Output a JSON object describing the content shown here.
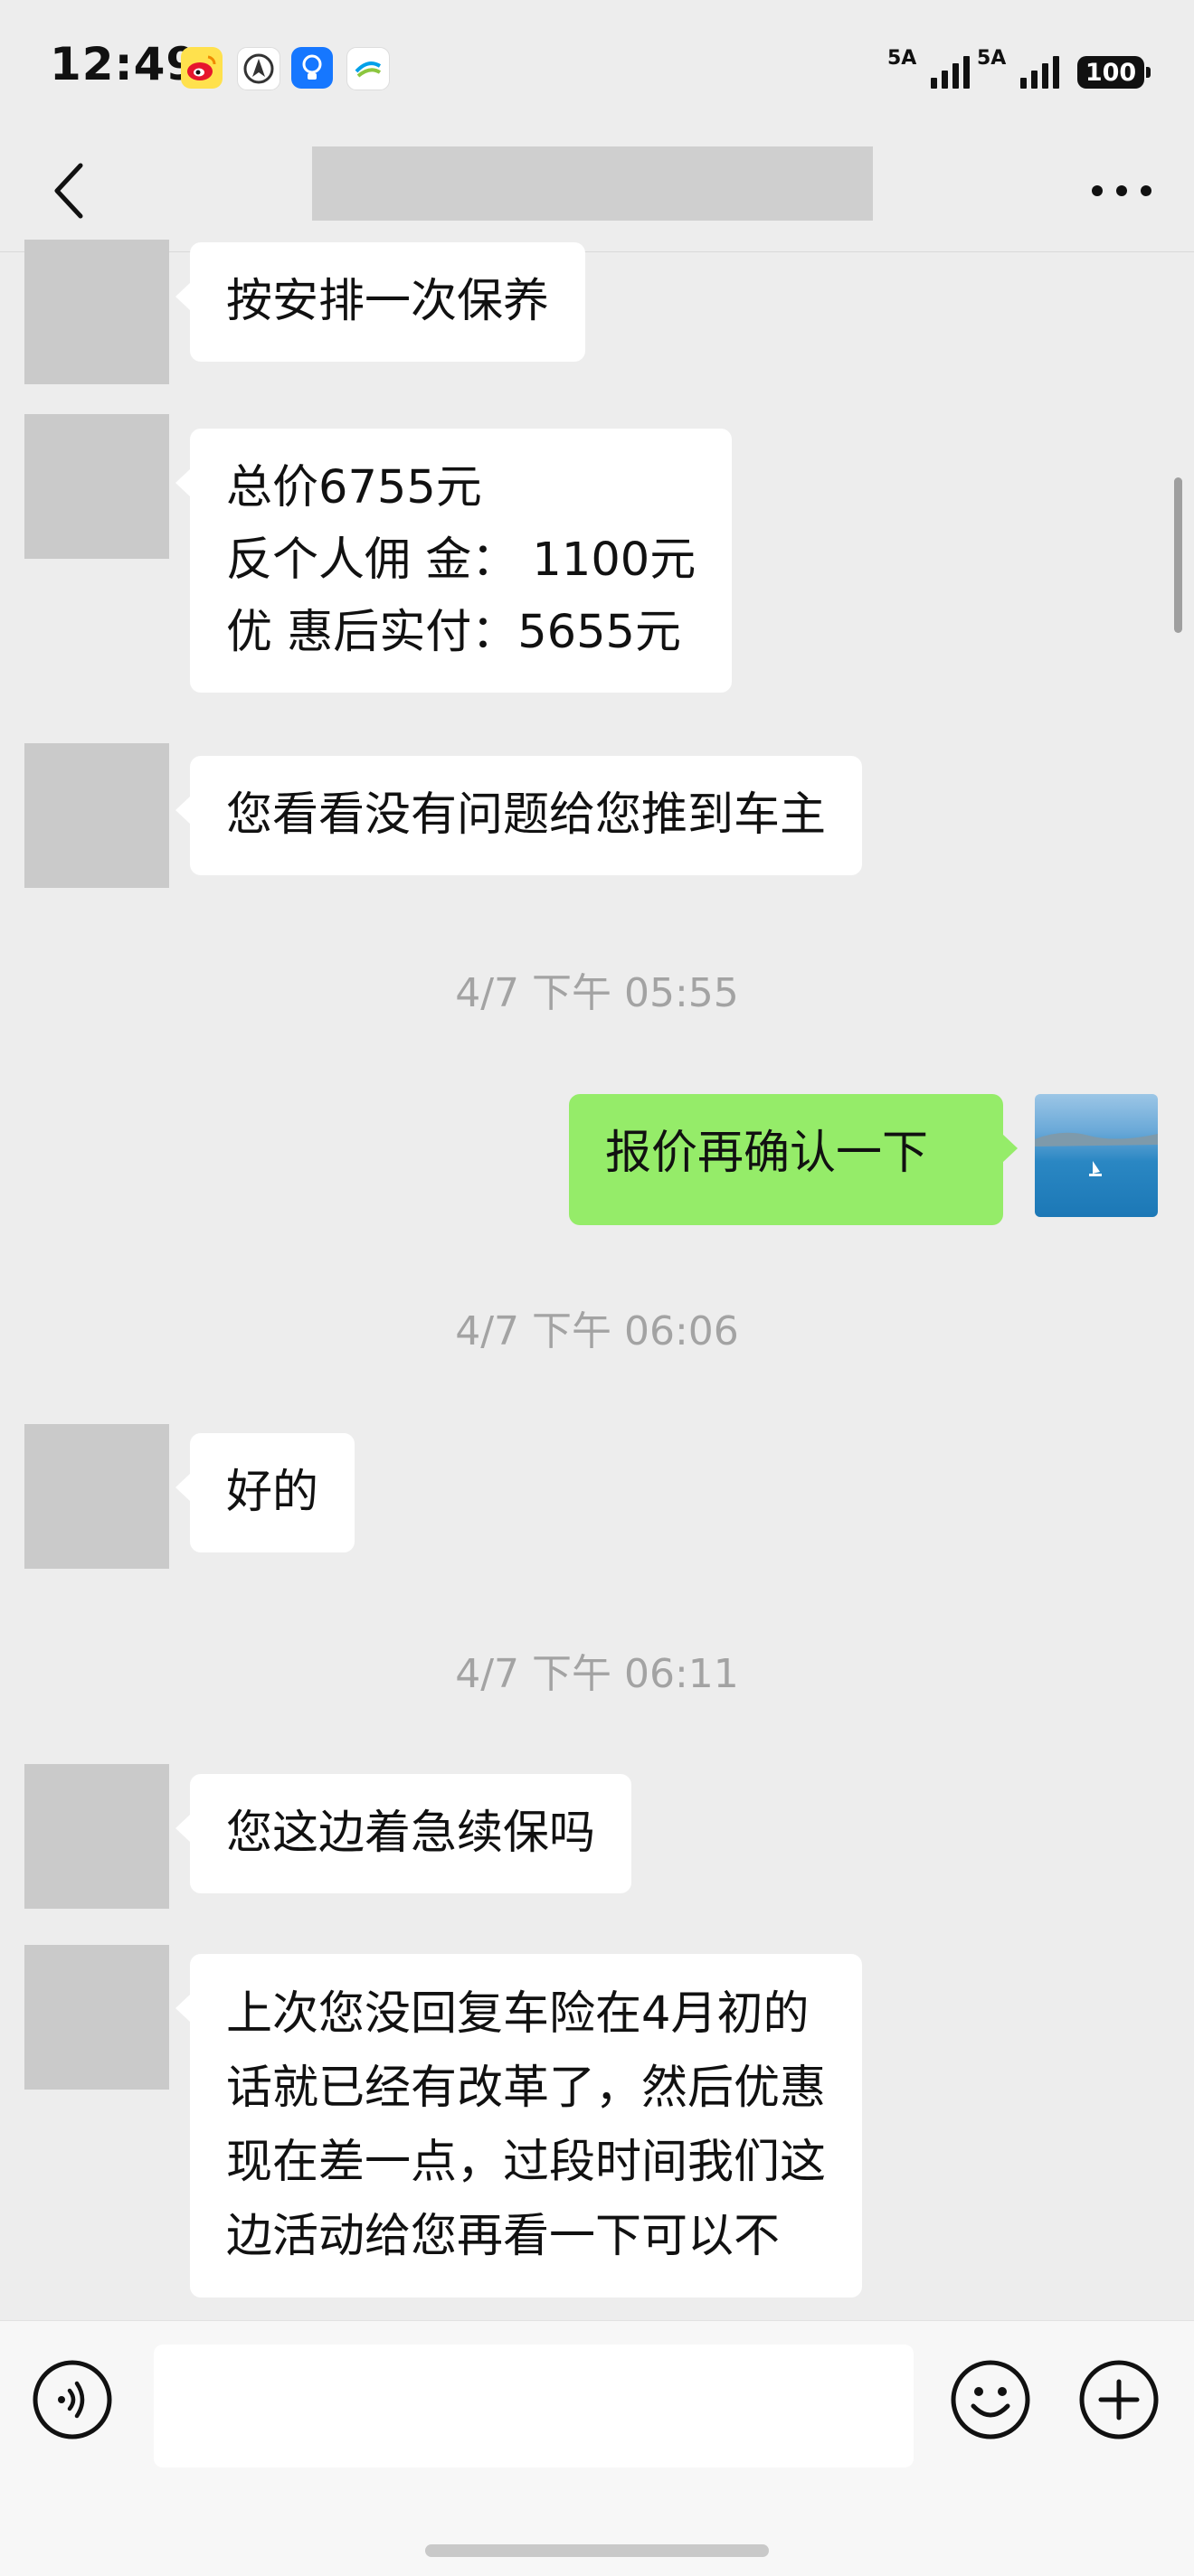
{
  "status_bar": {
    "time": "12:49",
    "network_1": "5A",
    "network_2": "5A",
    "battery": "100",
    "app_icons": [
      "weibo-icon",
      "compass-app-icon",
      "bulb-app-icon",
      "china-mobile-icon"
    ]
  },
  "header": {
    "title_redacted": true,
    "back_icon": "chevron-left-icon",
    "more_icon": "more-dots-icon"
  },
  "messages": [
    {
      "side": "left",
      "text": "按安排一次保养"
    },
    {
      "side": "left",
      "text": "总价6755元\n反个人佣 金：  1100元\n优 惠后实付：5655元"
    },
    {
      "side": "left",
      "text": "您看看没有问题给您推到车主"
    },
    {
      "type": "time",
      "text": "4/7 下午 05:55"
    },
    {
      "side": "right",
      "text": "报价再确认一下"
    },
    {
      "type": "time",
      "text": "4/7 下午 06:06"
    },
    {
      "side": "left",
      "text": "好的"
    },
    {
      "type": "time",
      "text": "4/7 下午 06:11"
    },
    {
      "side": "left",
      "text": "您这边着急续保吗"
    },
    {
      "side": "left",
      "text": "上次您没回复车险在4月初的\n话就已经有改革了，然后优惠\n现在差一点，过段时间我们这\n边活动给您再看一下可以不"
    }
  ],
  "input_bar": {
    "voice_icon": "voice-icon",
    "emoji_icon": "emoji-icon",
    "add_icon": "plus-circle-icon",
    "input_value": ""
  },
  "colors": {
    "background": "#ededed",
    "bubble_left": "#ffffff",
    "bubble_right": "#95ec69",
    "timestamp": "#a3a3a3"
  }
}
